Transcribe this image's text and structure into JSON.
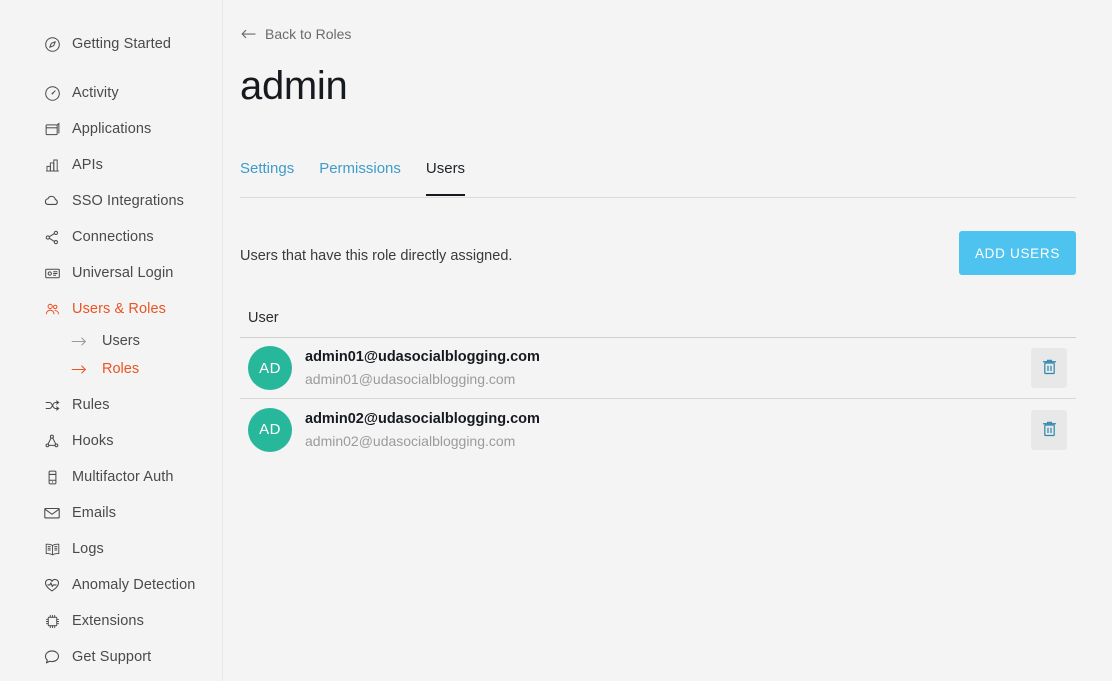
{
  "sidebar": {
    "items": [
      {
        "label": "Getting Started",
        "icon": "compass-icon",
        "active": false,
        "gap_after": true
      },
      {
        "label": "Activity",
        "icon": "gauge-icon",
        "active": false
      },
      {
        "label": "Applications",
        "icon": "applications-icon",
        "active": false
      },
      {
        "label": "APIs",
        "icon": "apis-icon",
        "active": false
      },
      {
        "label": "SSO Integrations",
        "icon": "cloud-icon",
        "active": false
      },
      {
        "label": "Connections",
        "icon": "connections-icon",
        "active": false
      },
      {
        "label": "Universal Login",
        "icon": "universal-login-icon",
        "active": false
      },
      {
        "label": "Users & Roles",
        "icon": "users-roles-icon",
        "active": true
      },
      {
        "label": "Rules",
        "icon": "rules-icon",
        "active": false
      },
      {
        "label": "Hooks",
        "icon": "hooks-icon",
        "active": false
      },
      {
        "label": "Multifactor Auth",
        "icon": "mfa-icon",
        "active": false
      },
      {
        "label": "Emails",
        "icon": "envelope-icon",
        "active": false
      },
      {
        "label": "Logs",
        "icon": "logs-icon",
        "active": false
      },
      {
        "label": "Anomaly Detection",
        "icon": "heartbeat-shield-icon",
        "active": false
      },
      {
        "label": "Extensions",
        "icon": "chip-icon",
        "active": false
      },
      {
        "label": "Get Support",
        "icon": "speech-bubble-icon",
        "active": false
      }
    ],
    "subitems": [
      {
        "label": "Users",
        "active": false
      },
      {
        "label": "Roles",
        "active": true
      }
    ],
    "accent_color": "#eb5424"
  },
  "main": {
    "back_link": "Back to Roles",
    "title": "admin",
    "tabs": [
      {
        "label": "Settings",
        "active": false
      },
      {
        "label": "Permissions",
        "active": false
      },
      {
        "label": "Users",
        "active": true
      }
    ],
    "description": "Users that have this role directly assigned.",
    "add_users_label": "ADD USERS",
    "add_users_color": "#4fc3ef",
    "table": {
      "columns": [
        "User"
      ],
      "rows": [
        {
          "initials": "AD",
          "name": "admin01@udasocialblogging.com",
          "email": "admin01@udasocialblogging.com",
          "avatar_color": "#27b79a",
          "delete_icon": "trash-icon"
        },
        {
          "initials": "AD",
          "name": "admin02@udasocialblogging.com",
          "email": "admin02@udasocialblogging.com",
          "avatar_color": "#27b79a",
          "delete_icon": "trash-icon"
        }
      ]
    }
  }
}
